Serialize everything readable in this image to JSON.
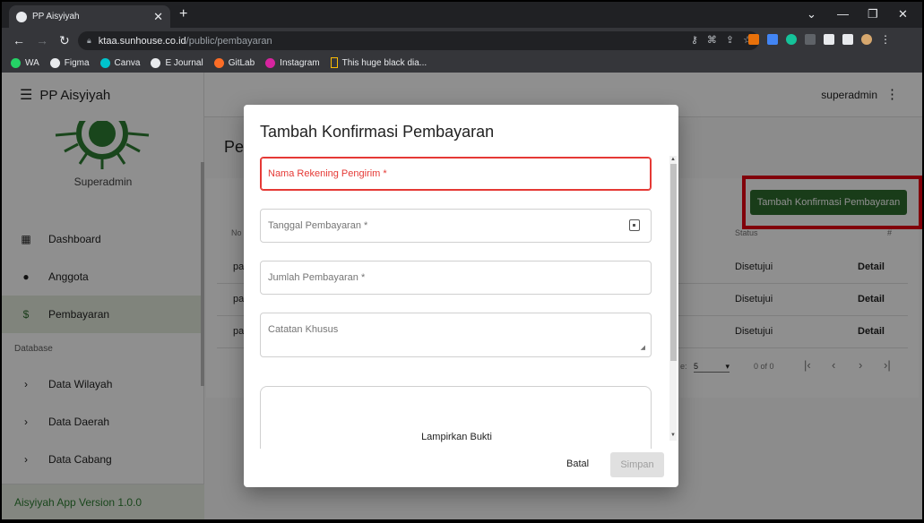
{
  "browser": {
    "tab_title": "PP Aisyiyah",
    "url_host": "ktaa.sunhouse.co.id",
    "url_path": "/public/pembayaran",
    "bookmarks": [
      "WA",
      "Figma",
      "Canva",
      "E Journal",
      "GitLab",
      "Instagram",
      "This huge black dia..."
    ]
  },
  "sidebar": {
    "app_title": "PP Aisyiyah",
    "user": "Superadmin",
    "items": [
      {
        "label": "Dashboard",
        "icon": "dashboard-icon"
      },
      {
        "label": "Anggota",
        "icon": "person-icon"
      },
      {
        "label": "Pembayaran",
        "icon": "payment-icon"
      }
    ],
    "section": "Database",
    "db_items": [
      "Data Wilayah",
      "Data Daerah",
      "Data Cabang"
    ],
    "version": "Aisyiyah App Version 1.0.0"
  },
  "appbar": {
    "user": "superadmin"
  },
  "page": {
    "title": "Pe",
    "add_button": "Tambah Konfirmasi Pembayaran",
    "headers": {
      "no": "No",
      "status": "Status",
      "action": "#"
    },
    "rows": [
      {
        "no": "pay",
        "status": "Disetujui",
        "action": "Detail"
      },
      {
        "no": "pay",
        "status": "Disetujui",
        "action": "Detail"
      },
      {
        "no": "pay",
        "status": "Disetujui",
        "action": "Detail"
      }
    ],
    "pager_label": "e:",
    "rows_per_page": "5",
    "range": "0 of 0"
  },
  "modal": {
    "title": "Tambah Konfirmasi Pembayaran",
    "fields": {
      "nama": "Nama Rekening Pengirim *",
      "tanggal": "Tanggal Pembayaran *",
      "jumlah": "Jumlah Pembayaran *",
      "catatan": "Catatan Khusus"
    },
    "upload": "Lampirkan Bukti",
    "cancel": "Batal",
    "save": "Simpan"
  }
}
